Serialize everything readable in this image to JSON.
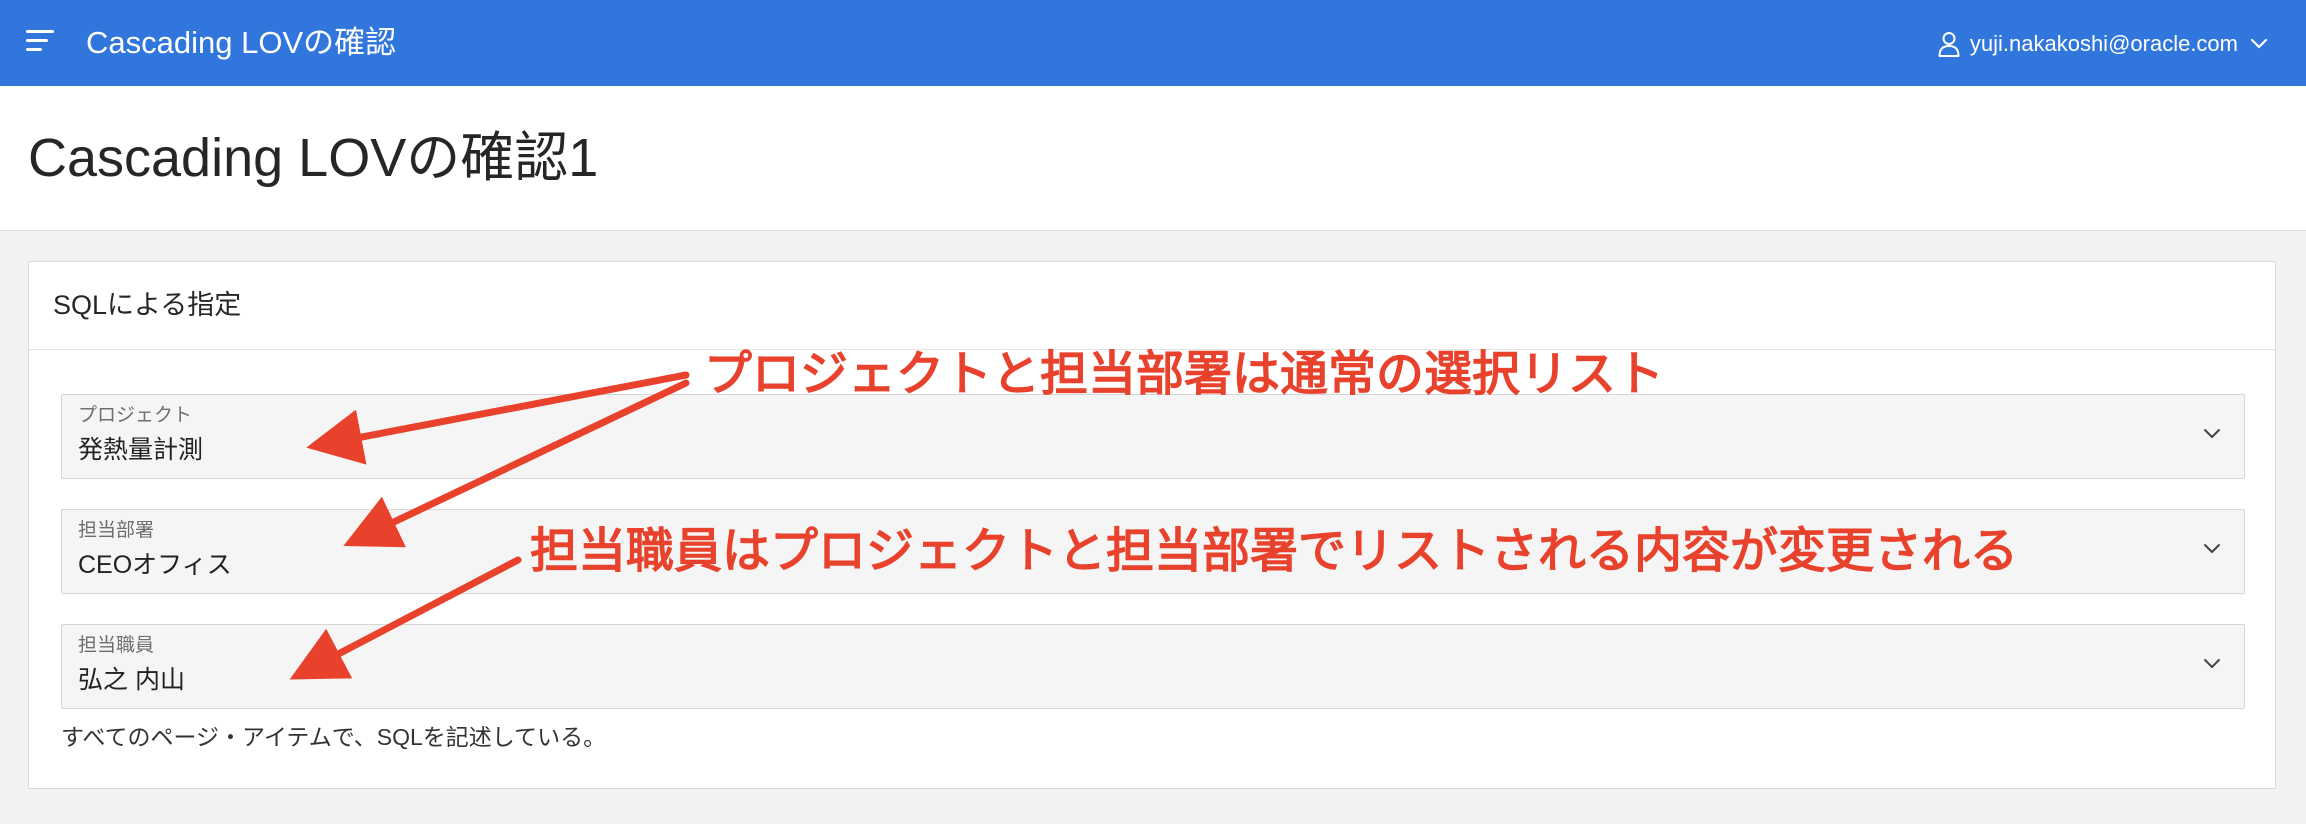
{
  "header": {
    "app_title": "Cascading LOVの確認",
    "user": "yuji.nakakoshi@oracle.com",
    "icons": {
      "menu": "hamburger-menu-icon",
      "user": "user-icon",
      "chevron": "chevron-down-icon"
    }
  },
  "page": {
    "title": "Cascading LOVの確認1"
  },
  "region": {
    "title": "SQLによる指定",
    "fields": [
      {
        "label": "プロジェクト",
        "value": "発熱量計測"
      },
      {
        "label": "担当部署",
        "value": "CEOオフィス"
      },
      {
        "label": "担当職員",
        "value": "弘之 内山"
      }
    ],
    "help_text": "すべてのページ・アイテムで、SQLを記述している。"
  },
  "annotations": [
    {
      "text": "プロジェクトと担当部署は通常の選択リスト"
    },
    {
      "text": "担当職員はプロジェクトと担当部署でリストされる内容が変更される"
    }
  ],
  "colors": {
    "header_bg": "#3076dc",
    "annotation": "#e8412c",
    "field_bg": "#f5f5f5",
    "page_bg": "#f2f2f2"
  }
}
